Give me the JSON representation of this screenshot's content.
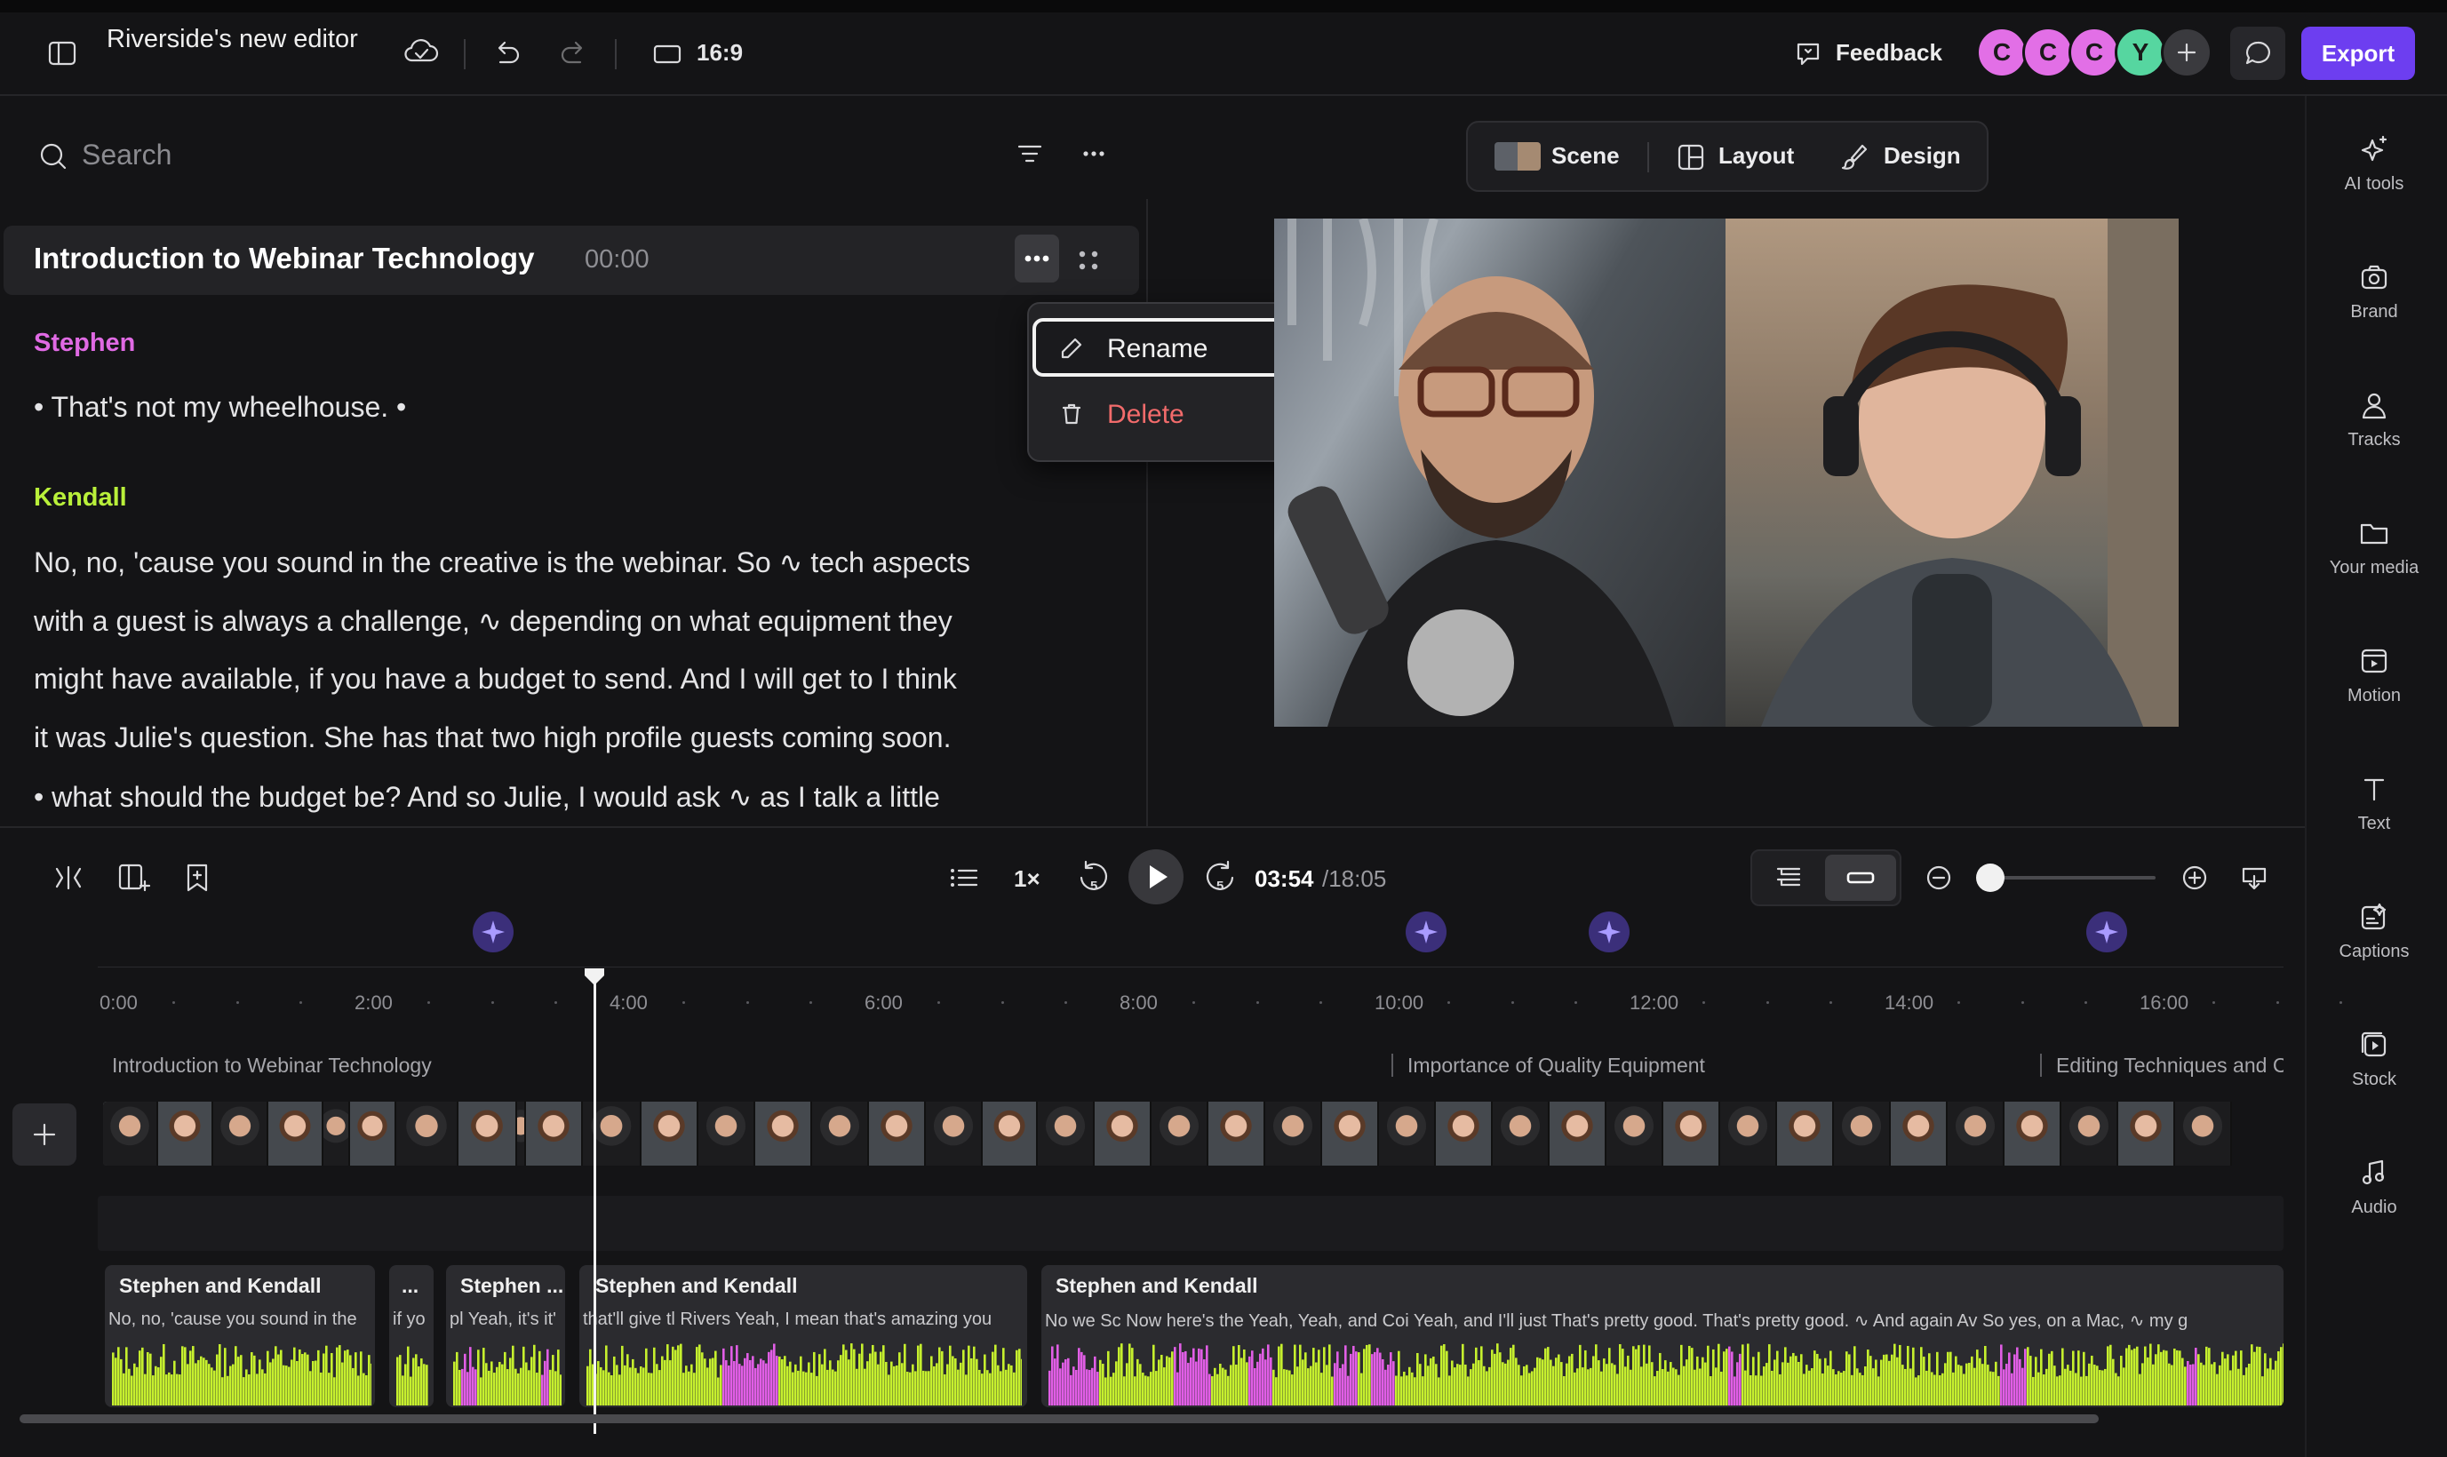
{
  "topbar": {
    "title": "Riverside's new editor",
    "aspect_ratio": "16:9",
    "feedback_label": "Feedback",
    "export_label": "Export",
    "collaborators": [
      {
        "initial": "C",
        "color": "#e26fe6"
      },
      {
        "initial": "C",
        "color": "#e26fe6"
      },
      {
        "initial": "C",
        "color": "#e26fe6"
      },
      {
        "initial": "Y",
        "color": "#56d6a0"
      }
    ]
  },
  "transcript": {
    "search_placeholder": "Search",
    "section": {
      "title": "Introduction to Webinar Technology",
      "time": "00:00"
    },
    "blocks": [
      {
        "speaker": "Stephen",
        "speaker_color": "#e06ae4",
        "lines": [
          "• That's not my wheelhouse. •"
        ]
      },
      {
        "speaker": "Kendall",
        "speaker_color": "#b9f03a",
        "lines": [
          "No, no, 'cause you sound in the creative is the webinar. So ∿ tech aspects",
          "with a guest is always a challenge, ∿ depending on what equipment they",
          "might have available, if you have a budget to send. And I will get to I think",
          "it was Julie's question. She has that two high profile guests coming soon.",
          "• what should the budget be? And so Julie, I would ask ∿ as I talk a little"
        ]
      }
    ]
  },
  "context_menu": {
    "rename": "Rename",
    "delete": "Delete"
  },
  "scene_toolbar": {
    "scene": "Scene",
    "layout": "Layout",
    "design": "Design"
  },
  "right_sidebar": [
    {
      "label": "AI tools",
      "icon": "sparkle-icon"
    },
    {
      "label": "Brand",
      "icon": "brand-icon"
    },
    {
      "label": "Tracks",
      "icon": "tracks-icon"
    },
    {
      "label": "Your media",
      "icon": "folder-icon"
    },
    {
      "label": "Motion",
      "icon": "motion-icon"
    },
    {
      "label": "Text",
      "icon": "text-icon"
    },
    {
      "label": "Captions",
      "icon": "captions-icon"
    },
    {
      "label": "Stock",
      "icon": "stock-icon"
    },
    {
      "label": "Audio",
      "icon": "music-icon"
    }
  ],
  "transport": {
    "speed": "1×",
    "current_time": "03:54",
    "total_time": "/18:05",
    "skip_back": "5",
    "skip_fwd": "5",
    "zoom_level": 0.0
  },
  "timeline": {
    "ruler": [
      "0:00",
      "2:00",
      "4:00",
      "6:00",
      "8:00",
      "10:00",
      "12:00",
      "14:00",
      "16:00"
    ],
    "chapters": [
      "Introduction to Webinar Technology",
      "Importance of Quality Equipment",
      "Editing Techniques and C"
    ],
    "audio_clips": [
      {
        "title": "Stephen and Kendall",
        "text": "No, no, 'cause you sound in the"
      },
      {
        "title": "...",
        "text": "if yo"
      },
      {
        "title": "Stephen ...",
        "text": "pl Yeah, it's it'"
      },
      {
        "title": "Stephen and Kendall",
        "text": "that'll give tl Rivers Yeah, I mean that's amazing you"
      },
      {
        "title": "Stephen and Kendall",
        "text": "No we Sc Now here's the Yeah, Yeah, and Coi Yeah, and I'll just   That's pretty good. That's pretty good. ∿ And again Av So yes, on a Mac, ∿ my g"
      }
    ]
  },
  "colors": {
    "accent": "#6d3ef0",
    "wave_green": "#c6f02e",
    "wave_pink": "#e15ee6",
    "delete_red": "#f26b6b"
  }
}
